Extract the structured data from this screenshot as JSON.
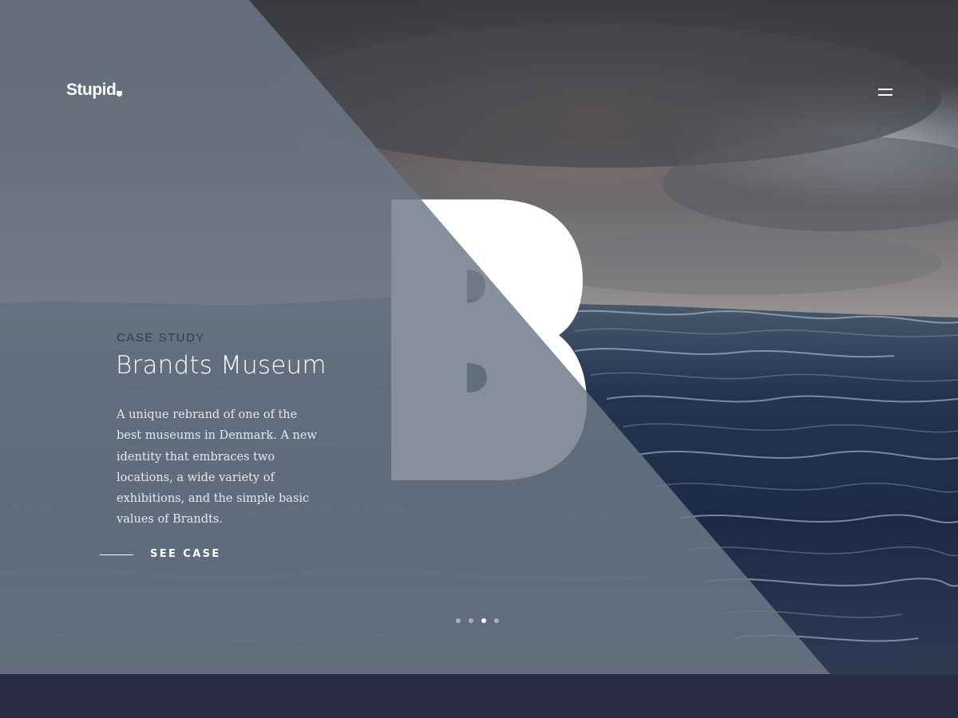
{
  "brand": {
    "name": "Stupid",
    "mark_icon": "heart-drop-icon"
  },
  "nav": {
    "menu_icon": "hamburger-menu-icon"
  },
  "hero": {
    "eyebrow": "CASE STUDY",
    "title": "Brandts Museum",
    "description": "A unique rebrand of one of the best museums in Denmark.  A new identity that embraces two locations,  a wide variety of exhibitions,  and the simple basic values of Brandts.",
    "cta_label": "SEE CASE",
    "background_image": "stormy-ocean-waves-photo",
    "monogram": "B"
  },
  "slider": {
    "total": 4,
    "active_index": 3
  },
  "colors": {
    "overlay": "#5f6b78",
    "eyebrow": "#2d3a55",
    "footer": "#2a2b45",
    "text": "#ffffff"
  }
}
